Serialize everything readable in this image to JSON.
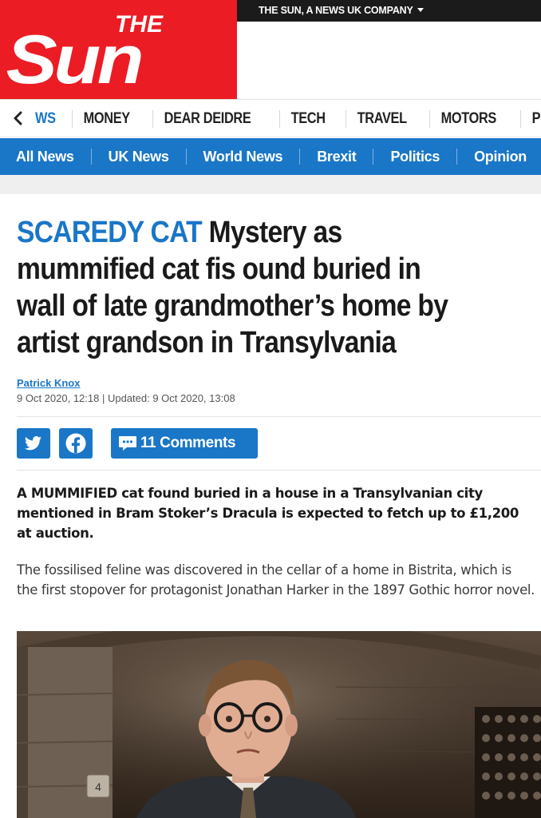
{
  "masthead": {
    "logo_text_top": "THE",
    "logo_text_main": "Sun",
    "company_link": "THE SUN, A NEWS UK COMPANY",
    "brand_red": "#eb1c24"
  },
  "section_nav": {
    "back_icon": "chevron-left-icon",
    "items": [
      "WS",
      "MONEY",
      "DEAR DEIDRE",
      "TECH",
      "TRAVEL",
      "MOTORS",
      "PUZZLES"
    ]
  },
  "sub_nav": {
    "items": [
      "All News",
      "UK News",
      "World News",
      "Brexit",
      "Politics",
      "Opinion"
    ],
    "bg_color": "#1a76c7"
  },
  "article": {
    "kicker": "SCAREDY CAT",
    "headline": "Mystery as mummified cat fis ound buried in wall of late grandmother’s home by artist grandson in Transylvania",
    "author": "Patrick Knox",
    "dateline": "9 Oct 2020, 12:18 | Updated: 9 Oct 2020, 13:08",
    "share": {
      "twitter_icon": "twitter-icon",
      "facebook_icon": "facebook-icon",
      "comments_icon": "comment-bubble-icon",
      "comments_label": "11 Comments"
    },
    "lead": "A MUMMIFIED cat found buried in a house in a Transylvanian city mentioned in Bram Stoker’s Dracula is expected to fetch up to £1,200 at auction.",
    "body": "The fossilised feline was discovered in the cellar of a home in Bistrita, which is the first stopover for protagonist Jonathan Harker in the 1897 Gothic horror novel.",
    "photo_tag_number": "4",
    "accent_color": "#1a76c7"
  }
}
